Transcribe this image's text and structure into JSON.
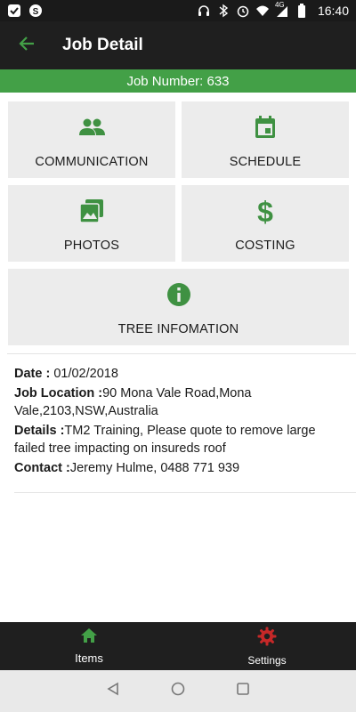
{
  "status_bar": {
    "time": "16:40",
    "network": "4G",
    "icons": [
      "notification-icon",
      "app-icon",
      "headset-icon",
      "bluetooth-icon",
      "alarm-icon",
      "wifi-icon",
      "signal-icon",
      "battery-icon"
    ]
  },
  "app_bar": {
    "title": "Job Detail",
    "back_icon": "arrow-back-icon"
  },
  "job_banner": {
    "text": "Job Number: 633"
  },
  "tiles": [
    {
      "label": "COMMUNICATION",
      "icon": "people-icon"
    },
    {
      "label": "SCHEDULE",
      "icon": "calendar-icon"
    },
    {
      "label": "PHOTOS",
      "icon": "photos-icon"
    },
    {
      "label": "COSTING",
      "icon": "dollar-icon"
    },
    {
      "label": "TREE INFOMATION",
      "icon": "info-icon"
    }
  ],
  "details": {
    "date_key": "Date : ",
    "date_value": "01/02/2018",
    "location_key": "Job Location :",
    "location_value": "90 Mona Vale Road,Mona Vale,2103,NSW,Australia",
    "details_key": "Details :",
    "details_value": "TM2 Training, Please quote to remove large failed tree impacting on insureds roof",
    "contact_key": "Contact :",
    "contact_value": "Jeremy Hulme, 0488 771 939"
  },
  "bottom_nav": {
    "items": [
      {
        "label": "Items",
        "icon": "home-icon"
      },
      {
        "label": "Settings",
        "icon": "settings-gear-icon"
      }
    ]
  },
  "colors": {
    "accent_green": "#43a047",
    "icon_green": "#3f9142",
    "settings_icon_red": "#c62828",
    "app_bar": "#1f1f1f",
    "tile_bg": "#ececec"
  }
}
